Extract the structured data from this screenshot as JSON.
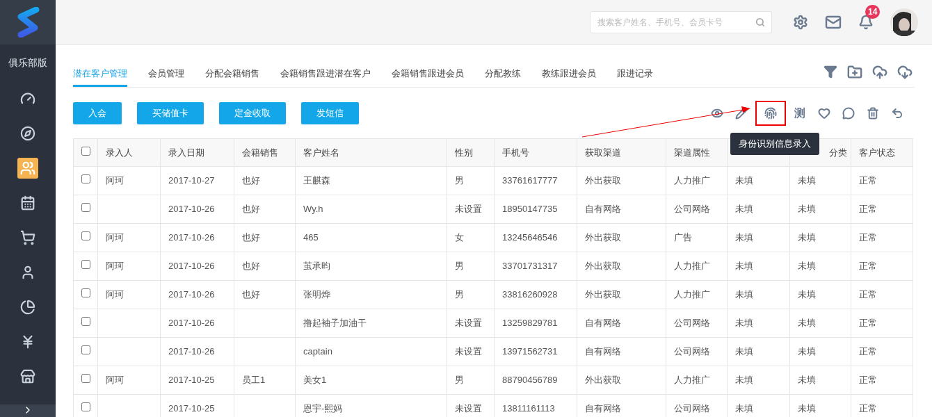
{
  "sidebar": {
    "title": "俱乐部版",
    "items": [
      {
        "selected": false
      },
      {
        "selected": false
      },
      {
        "selected": true
      },
      {
        "selected": false
      },
      {
        "selected": false
      },
      {
        "selected": false
      },
      {
        "selected": false
      },
      {
        "selected": false
      },
      {
        "selected": false
      }
    ]
  },
  "header": {
    "search": {
      "placeholder": "搜索客户姓名、手机号、会员卡号"
    },
    "notifications": "14"
  },
  "tabs": [
    {
      "label": "潜在客户管理",
      "selected": true
    },
    {
      "label": "会员管理",
      "selected": false
    },
    {
      "label": "分配会籍销售",
      "selected": false
    },
    {
      "label": "会籍销售跟进潜在客户",
      "selected": false
    },
    {
      "label": "会籍销售跟进会员",
      "selected": false
    },
    {
      "label": "分配教练",
      "selected": false
    },
    {
      "label": "教练跟进会员",
      "selected": false
    },
    {
      "label": "跟进记录",
      "selected": false
    }
  ],
  "actions": [
    "入会",
    "买储值卡",
    "定金收取",
    "发短信"
  ],
  "toolbar": [
    {
      "kind": "icon",
      "highlighted": false
    },
    {
      "kind": "icon",
      "highlighted": false
    },
    {
      "kind": "icon",
      "highlighted": true
    },
    {
      "kind": "text",
      "label": "测",
      "highlighted": false
    },
    {
      "kind": "icon",
      "highlighted": false
    },
    {
      "kind": "icon",
      "highlighted": false
    },
    {
      "kind": "icon",
      "highlighted": false
    },
    {
      "kind": "icon",
      "highlighted": false
    }
  ],
  "tooltip": "身份识别信息录入",
  "table": {
    "all_checked": false,
    "columns": [
      "录入人",
      "录入日期",
      "会籍销售",
      "客户姓名",
      "性别",
      "手机号",
      "获取渠道",
      "渠道属性",
      null,
      "分类",
      "客户状态"
    ],
    "rows": [
      {
        "checked": false,
        "cells": [
          "阿珂",
          "2017-10-27",
          "也好",
          "王麒森",
          "男",
          "33761617777",
          "外出获取",
          "人力推广",
          "未填",
          "未填",
          "正常"
        ]
      },
      {
        "checked": false,
        "cells": [
          "",
          "2017-10-26",
          "也好",
          "Wy.h",
          "未设置",
          "18950147735",
          "自有网络",
          "公司网络",
          "未填",
          "未填",
          "正常"
        ]
      },
      {
        "checked": false,
        "cells": [
          "阿珂",
          "2017-10-26",
          "也好",
          "465",
          "女",
          "13245646546",
          "外出获取",
          "广告",
          "未填",
          "未填",
          "正常"
        ]
      },
      {
        "checked": false,
        "cells": [
          "阿珂",
          "2017-10-26",
          "也好",
          "茧承昀",
          "男",
          "33701731317",
          "外出获取",
          "人力推广",
          "未填",
          "未填",
          "正常"
        ]
      },
      {
        "checked": false,
        "cells": [
          "阿珂",
          "2017-10-26",
          "也好",
          "张明烨",
          "男",
          "33816260928",
          "外出获取",
          "人力推广",
          "未填",
          "未填",
          "正常"
        ]
      },
      {
        "checked": false,
        "cells": [
          "",
          "2017-10-26",
          "",
          "撸起袖子加油干",
          "未设置",
          "13259829781",
          "自有网络",
          "公司网络",
          "未填",
          "未填",
          "正常"
        ]
      },
      {
        "checked": false,
        "cells": [
          "",
          "2017-10-26",
          "",
          "captain",
          "未设置",
          "13971562731",
          "自有网络",
          "公司网络",
          "未填",
          "未填",
          "正常"
        ]
      },
      {
        "checked": false,
        "cells": [
          "阿珂",
          "2017-10-25",
          "员工1",
          "美女1",
          "男",
          "88790456789",
          "外出获取",
          "人力推广",
          "未填",
          "未填",
          "正常"
        ]
      },
      {
        "checked": false,
        "cells": [
          "",
          "2017-10-25",
          "",
          "恩宇-熙妈",
          "未设置",
          "13811161113",
          "自有网络",
          "公司网络",
          "未填",
          "未填",
          "正常"
        ]
      }
    ]
  }
}
